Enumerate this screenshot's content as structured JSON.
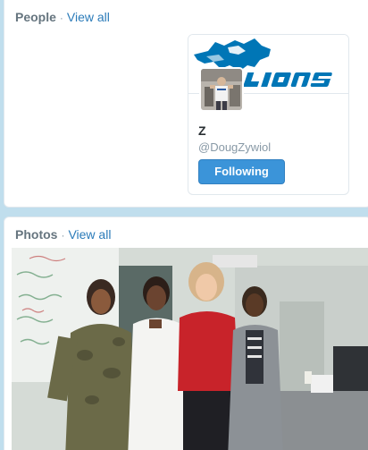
{
  "people_module": {
    "title": "People",
    "separator": "·",
    "view_all": "View all",
    "card": {
      "name": "Z",
      "handle": "@DougZywiol",
      "follow_button": "Following",
      "banner_text": "LIONS",
      "banner_icon": "lion-logo-icon"
    }
  },
  "photos_module": {
    "title": "Photos",
    "separator": "·",
    "view_all": "View all"
  },
  "colors": {
    "background": "#c0deed",
    "link": "#2b7bb9",
    "button": "#3b94d9",
    "lions_blue": "#0076b6"
  }
}
